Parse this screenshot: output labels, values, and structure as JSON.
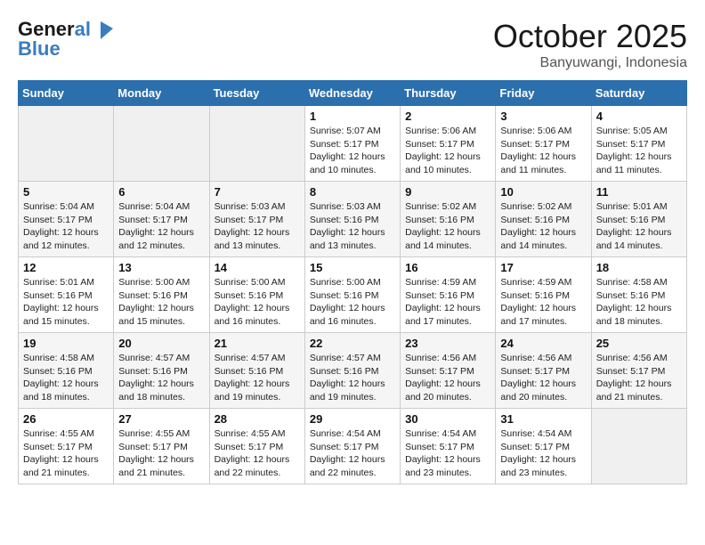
{
  "header": {
    "logo_line1": "General",
    "logo_line2": "Blue",
    "month": "October 2025",
    "location": "Banyuwangi, Indonesia"
  },
  "days_of_week": [
    "Sunday",
    "Monday",
    "Tuesday",
    "Wednesday",
    "Thursday",
    "Friday",
    "Saturday"
  ],
  "weeks": [
    [
      {
        "day": "",
        "info": ""
      },
      {
        "day": "",
        "info": ""
      },
      {
        "day": "",
        "info": ""
      },
      {
        "day": "1",
        "info": "Sunrise: 5:07 AM\nSunset: 5:17 PM\nDaylight: 12 hours\nand 10 minutes."
      },
      {
        "day": "2",
        "info": "Sunrise: 5:06 AM\nSunset: 5:17 PM\nDaylight: 12 hours\nand 10 minutes."
      },
      {
        "day": "3",
        "info": "Sunrise: 5:06 AM\nSunset: 5:17 PM\nDaylight: 12 hours\nand 11 minutes."
      },
      {
        "day": "4",
        "info": "Sunrise: 5:05 AM\nSunset: 5:17 PM\nDaylight: 12 hours\nand 11 minutes."
      }
    ],
    [
      {
        "day": "5",
        "info": "Sunrise: 5:04 AM\nSunset: 5:17 PM\nDaylight: 12 hours\nand 12 minutes."
      },
      {
        "day": "6",
        "info": "Sunrise: 5:04 AM\nSunset: 5:17 PM\nDaylight: 12 hours\nand 12 minutes."
      },
      {
        "day": "7",
        "info": "Sunrise: 5:03 AM\nSunset: 5:17 PM\nDaylight: 12 hours\nand 13 minutes."
      },
      {
        "day": "8",
        "info": "Sunrise: 5:03 AM\nSunset: 5:16 PM\nDaylight: 12 hours\nand 13 minutes."
      },
      {
        "day": "9",
        "info": "Sunrise: 5:02 AM\nSunset: 5:16 PM\nDaylight: 12 hours\nand 14 minutes."
      },
      {
        "day": "10",
        "info": "Sunrise: 5:02 AM\nSunset: 5:16 PM\nDaylight: 12 hours\nand 14 minutes."
      },
      {
        "day": "11",
        "info": "Sunrise: 5:01 AM\nSunset: 5:16 PM\nDaylight: 12 hours\nand 14 minutes."
      }
    ],
    [
      {
        "day": "12",
        "info": "Sunrise: 5:01 AM\nSunset: 5:16 PM\nDaylight: 12 hours\nand 15 minutes."
      },
      {
        "day": "13",
        "info": "Sunrise: 5:00 AM\nSunset: 5:16 PM\nDaylight: 12 hours\nand 15 minutes."
      },
      {
        "day": "14",
        "info": "Sunrise: 5:00 AM\nSunset: 5:16 PM\nDaylight: 12 hours\nand 16 minutes."
      },
      {
        "day": "15",
        "info": "Sunrise: 5:00 AM\nSunset: 5:16 PM\nDaylight: 12 hours\nand 16 minutes."
      },
      {
        "day": "16",
        "info": "Sunrise: 4:59 AM\nSunset: 5:16 PM\nDaylight: 12 hours\nand 17 minutes."
      },
      {
        "day": "17",
        "info": "Sunrise: 4:59 AM\nSunset: 5:16 PM\nDaylight: 12 hours\nand 17 minutes."
      },
      {
        "day": "18",
        "info": "Sunrise: 4:58 AM\nSunset: 5:16 PM\nDaylight: 12 hours\nand 18 minutes."
      }
    ],
    [
      {
        "day": "19",
        "info": "Sunrise: 4:58 AM\nSunset: 5:16 PM\nDaylight: 12 hours\nand 18 minutes."
      },
      {
        "day": "20",
        "info": "Sunrise: 4:57 AM\nSunset: 5:16 PM\nDaylight: 12 hours\nand 18 minutes."
      },
      {
        "day": "21",
        "info": "Sunrise: 4:57 AM\nSunset: 5:16 PM\nDaylight: 12 hours\nand 19 minutes."
      },
      {
        "day": "22",
        "info": "Sunrise: 4:57 AM\nSunset: 5:16 PM\nDaylight: 12 hours\nand 19 minutes."
      },
      {
        "day": "23",
        "info": "Sunrise: 4:56 AM\nSunset: 5:17 PM\nDaylight: 12 hours\nand 20 minutes."
      },
      {
        "day": "24",
        "info": "Sunrise: 4:56 AM\nSunset: 5:17 PM\nDaylight: 12 hours\nand 20 minutes."
      },
      {
        "day": "25",
        "info": "Sunrise: 4:56 AM\nSunset: 5:17 PM\nDaylight: 12 hours\nand 21 minutes."
      }
    ],
    [
      {
        "day": "26",
        "info": "Sunrise: 4:55 AM\nSunset: 5:17 PM\nDaylight: 12 hours\nand 21 minutes."
      },
      {
        "day": "27",
        "info": "Sunrise: 4:55 AM\nSunset: 5:17 PM\nDaylight: 12 hours\nand 21 minutes."
      },
      {
        "day": "28",
        "info": "Sunrise: 4:55 AM\nSunset: 5:17 PM\nDaylight: 12 hours\nand 22 minutes."
      },
      {
        "day": "29",
        "info": "Sunrise: 4:54 AM\nSunset: 5:17 PM\nDaylight: 12 hours\nand 22 minutes."
      },
      {
        "day": "30",
        "info": "Sunrise: 4:54 AM\nSunset: 5:17 PM\nDaylight: 12 hours\nand 23 minutes."
      },
      {
        "day": "31",
        "info": "Sunrise: 4:54 AM\nSunset: 5:17 PM\nDaylight: 12 hours\nand 23 minutes."
      },
      {
        "day": "",
        "info": ""
      }
    ]
  ]
}
